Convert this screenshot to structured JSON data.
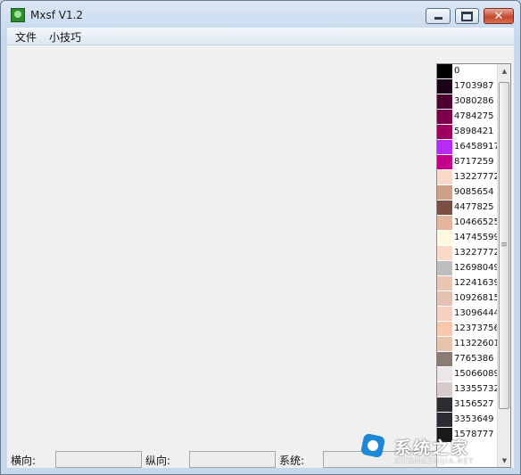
{
  "window": {
    "title": "Mxsf V1.2",
    "close_glyph": "✕"
  },
  "menu": {
    "file": "文件",
    "tips": "小技巧"
  },
  "palette": {
    "items": [
      {
        "color": "#000000",
        "value": "0"
      },
      {
        "color": "#1a0019",
        "value": "1703987"
      },
      {
        "color": "#4e0030",
        "value": "3080286"
      },
      {
        "color": "#7a004a",
        "value": "4784275"
      },
      {
        "color": "#9e0060",
        "value": "5898421"
      },
      {
        "color": "#b42cf5",
        "value": "16458917"
      },
      {
        "color": "#c4008a",
        "value": "8717259"
      },
      {
        "color": "#f7d8c9",
        "value": "13227772"
      },
      {
        "color": "#cda08a",
        "value": "9085654"
      },
      {
        "color": "#7a5044",
        "value": "4477825"
      },
      {
        "color": "#e3b59f",
        "value": "10466525"
      },
      {
        "color": "#fff9e0",
        "value": "14745599"
      },
      {
        "color": "#f7d8c9",
        "value": "13227772"
      },
      {
        "color": "#bebebe",
        "value": "12698049"
      },
      {
        "color": "#eac5b4",
        "value": "12241639"
      },
      {
        "color": "#e2c0b2",
        "value": "10926815"
      },
      {
        "color": "#f6d0c3",
        "value": "13096444"
      },
      {
        "color": "#f7c7ae",
        "value": "12373756"
      },
      {
        "color": "#e8c4ac",
        "value": "11322601"
      },
      {
        "color": "#8a7b75",
        "value": "7765386"
      },
      {
        "color": "#ede6e6",
        "value": "15066089"
      },
      {
        "color": "#d6cccc",
        "value": "13355732"
      },
      {
        "color": "#2e2b30",
        "value": "3156527"
      },
      {
        "color": "#2c2a32",
        "value": "3353649"
      },
      {
        "color": "#1a1a1a",
        "value": "1578777"
      }
    ]
  },
  "status": {
    "horizontal_label": "横向:",
    "vertical_label": "纵向:",
    "system_label": "系统:",
    "horizontal_value": "",
    "vertical_value": "",
    "system_value": ""
  },
  "watermark": {
    "text": "系统之家",
    "sub": "XITONGZHIJIA.NET"
  }
}
